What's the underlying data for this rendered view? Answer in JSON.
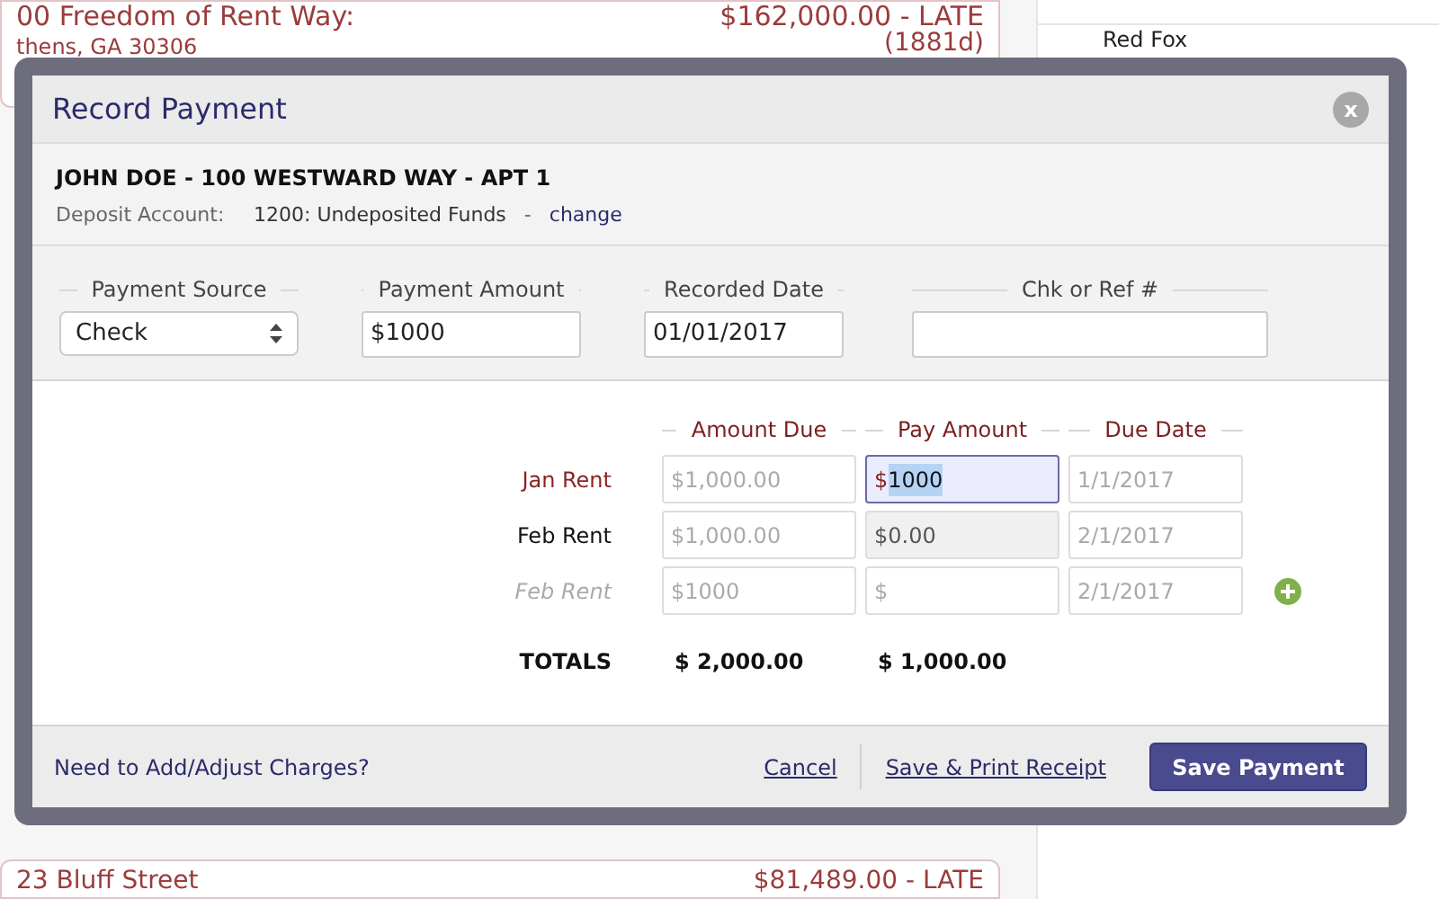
{
  "background": {
    "cards": [
      {
        "address": "00 Freedom of Rent Way:",
        "city": "thens, GA 30306",
        "balance": "$162,000.00 - LATE",
        "days": "(1881d)"
      },
      {
        "address": "23 Bluff Street",
        "balance": "$81,489.00 - LATE"
      }
    ],
    "sidebar": {
      "items": [
        "Red Fox"
      ]
    }
  },
  "dialog": {
    "title": "Record Payment",
    "close": "x",
    "tenant": "JOHN DOE - 100 WESTWARD WAY - APT 1",
    "deposit_account": {
      "label": "Deposit Account:",
      "value": "1200: Undeposited Funds",
      "separator": "-",
      "link": "change"
    },
    "fields": [
      {
        "kind": "select",
        "label": "Payment Source",
        "value": "Check"
      },
      {
        "kind": "money",
        "label": "Payment Amount",
        "prefix": "$",
        "value": "1000"
      },
      {
        "kind": "text",
        "label": "Recorded Date",
        "value": "01/01/2017"
      },
      {
        "kind": "text",
        "label": "Chk or Ref #"
      }
    ],
    "columns": [
      "Amount Due",
      "Pay Amount",
      "Due Date"
    ],
    "rows": [
      {
        "kind": "charge",
        "label": "Jan Rent",
        "amount_due": "1,000.00",
        "pay_amount": "1000",
        "due_date": "1/1/2017",
        "selected": true,
        "pay_disabled": false
      },
      {
        "kind": "charge",
        "label": "Feb Rent",
        "amount_due": "1,000.00",
        "pay_amount": "0.00",
        "due_date": "2/1/2017",
        "selected": false,
        "pay_disabled": true
      },
      {
        "kind": "new",
        "label": "Feb Rent",
        "amount_due": "1000",
        "due_date": "2/1/2017",
        "selected": false,
        "pay_disabled": false
      }
    ],
    "currency": "$",
    "totals": {
      "label": "TOTALS",
      "amount_due": "$ 2,000.00",
      "pay_amount": "$ 1,000.00"
    },
    "footer": {
      "link": "Need to Add/Adjust Charges?",
      "cancel": "Cancel",
      "print": "Save & Print Receipt",
      "save": "Save Payment"
    }
  }
}
